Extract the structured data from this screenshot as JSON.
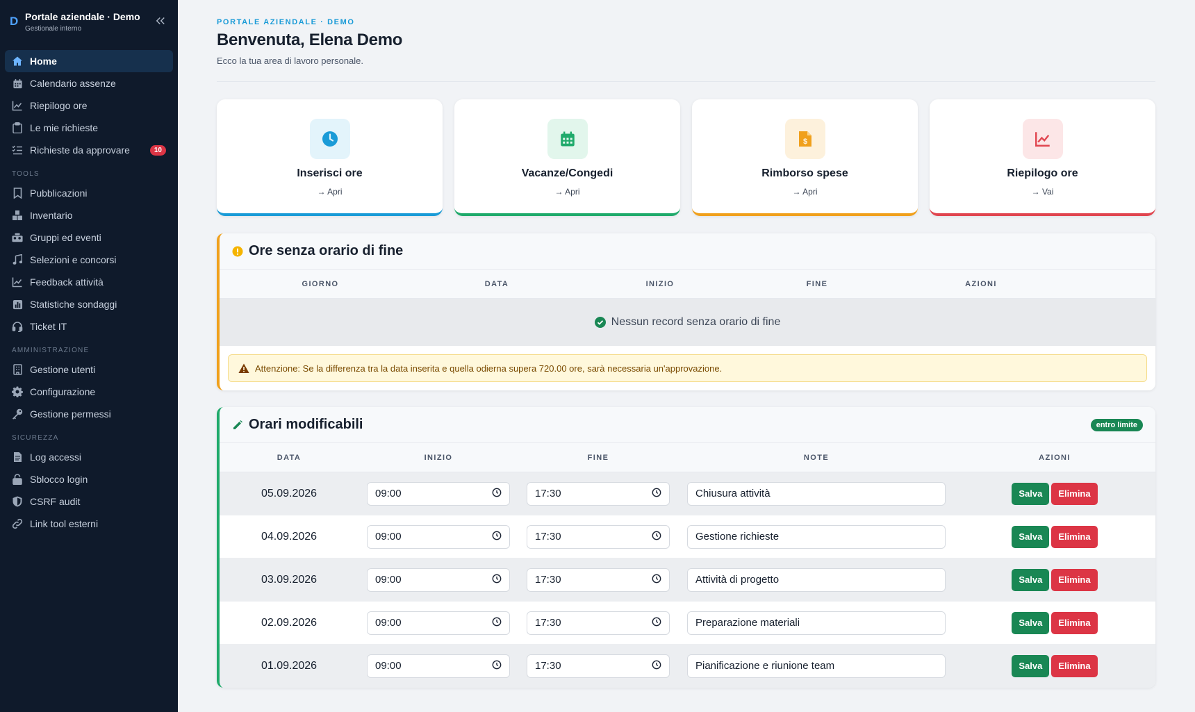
{
  "brand": {
    "logo": "D",
    "title": "Portale aziendale · Demo",
    "subtitle": "Gestionale interno"
  },
  "nav": {
    "main": [
      {
        "label": "Home",
        "icon": "home-icon",
        "active": true
      },
      {
        "label": "Calendario assenze",
        "icon": "calendar-icon"
      },
      {
        "label": "Riepilogo ore",
        "icon": "chart-line-icon"
      },
      {
        "label": "Le mie richieste",
        "icon": "clipboard-icon"
      },
      {
        "label": "Richieste da approvare",
        "icon": "list-check-icon",
        "badge": "10"
      }
    ],
    "tools_label": "TOOLS",
    "tools": [
      {
        "label": "Pubblicazioni",
        "icon": "bookmark-icon"
      },
      {
        "label": "Inventario",
        "icon": "boxes-icon"
      },
      {
        "label": "Gruppi ed eventi",
        "icon": "users-icon"
      },
      {
        "label": "Selezioni e concorsi",
        "icon": "music-icon"
      },
      {
        "label": "Feedback attività",
        "icon": "chart-line-icon"
      },
      {
        "label": "Statistiche sondaggi",
        "icon": "poll-icon"
      },
      {
        "label": "Ticket IT",
        "icon": "headset-icon"
      }
    ],
    "admin_label": "AMMINISTRAZIONE",
    "admin": [
      {
        "label": "Gestione utenti",
        "icon": "building-icon"
      },
      {
        "label": "Configurazione",
        "icon": "gear-icon"
      },
      {
        "label": "Gestione permessi",
        "icon": "key-icon"
      }
    ],
    "security_label": "SICUREZZA",
    "security": [
      {
        "label": "Log accessi",
        "icon": "file-icon"
      },
      {
        "label": "Sblocco login",
        "icon": "lock-icon"
      },
      {
        "label": "CSRF audit",
        "icon": "shield-icon"
      },
      {
        "label": "Link tool esterni",
        "icon": "link-icon"
      }
    ]
  },
  "header": {
    "eyebrow": "PORTALE AZIENDALE · DEMO",
    "title": "Benvenuta, Elena Demo",
    "subtitle": "Ecco la tua area di lavoro personale."
  },
  "cards": [
    {
      "title": "Inserisci ore",
      "link": "Apri",
      "icon": "clock-icon",
      "color": "#1a9bd7",
      "bg": "#e3f4fb"
    },
    {
      "title": "Vacanze/Congedi",
      "link": "Apri",
      "icon": "calendar-icon",
      "color": "#1faa6b",
      "bg": "#e2f6ec"
    },
    {
      "title": "Rimborso spese",
      "link": "Apri",
      "icon": "receipt-icon",
      "color": "#f0a01c",
      "bg": "#fdf1dc"
    },
    {
      "title": "Riepilogo ore",
      "link": "Vai",
      "icon": "chart-line-icon",
      "color": "#e0454f",
      "bg": "#fce6e7"
    }
  ],
  "missing_end": {
    "title": "Ore senza orario di fine",
    "columns": [
      "GIORNO",
      "DATA",
      "INIZIO",
      "FINE",
      "AZIONI"
    ],
    "empty_text": "Nessun record senza orario di fine",
    "alert": "Attenzione: Se la differenza tra la data inserita e quella odierna supera 720.00 ore, sarà necessaria un'approvazione.",
    "accent": "#f0a01c"
  },
  "editable": {
    "title": "Orari modificabili",
    "badge": "entro limite",
    "columns": [
      "DATA",
      "INIZIO",
      "FINE",
      "NOTE",
      "AZIONI"
    ],
    "save_label": "Salva",
    "delete_label": "Elimina",
    "accent": "#1faa6b",
    "rows": [
      {
        "date": "05.09.2026",
        "start": "09:00",
        "end": "17:30",
        "note": "Chiusura attività"
      },
      {
        "date": "04.09.2026",
        "start": "09:00",
        "end": "17:30",
        "note": "Gestione richieste"
      },
      {
        "date": "03.09.2026",
        "start": "09:00",
        "end": "17:30",
        "note": "Attività di progetto"
      },
      {
        "date": "02.09.2026",
        "start": "09:00",
        "end": "17:30",
        "note": "Preparazione materiali"
      },
      {
        "date": "01.09.2026",
        "start": "09:00",
        "end": "17:30",
        "note": "Pianificazione e riunione team"
      }
    ]
  }
}
